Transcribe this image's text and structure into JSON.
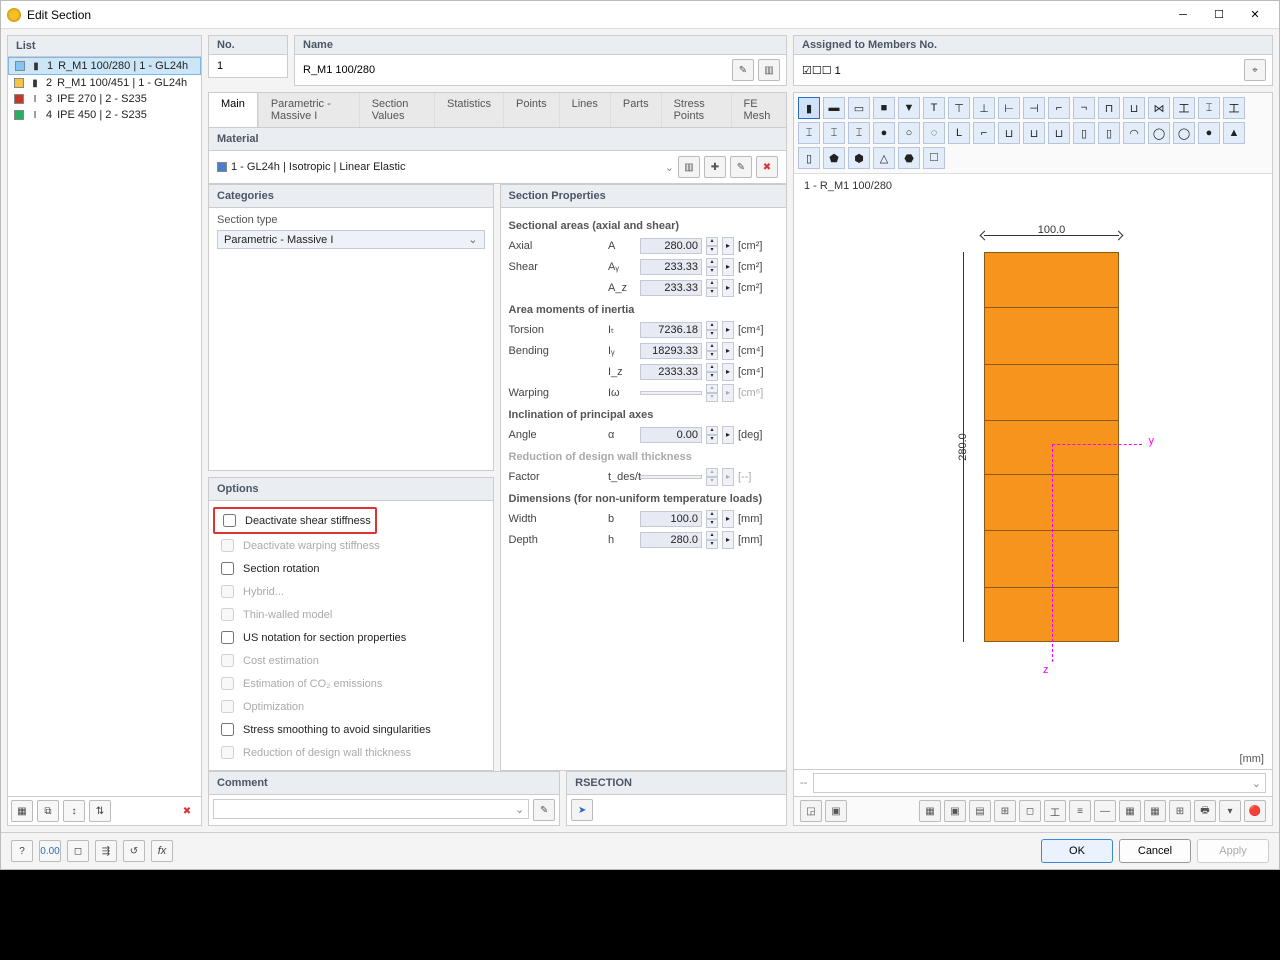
{
  "title": "Edit Section",
  "left": {
    "header": "List",
    "items": [
      {
        "idx": "1",
        "name": "R_M1 100/280 | 1 - GL24h",
        "color": "#7ec6f5",
        "shape": "rect",
        "selected": true
      },
      {
        "idx": "2",
        "name": "R_M1 100/451 | 1 - GL24h",
        "color": "#f4c542",
        "shape": "rect"
      },
      {
        "idx": "3",
        "name": "IPE 270 | 2 - S235",
        "color": "#c0392b",
        "shape": "I"
      },
      {
        "idx": "4",
        "name": "IPE 450 | 2 - S235",
        "color": "#27ae60",
        "shape": "I"
      }
    ]
  },
  "top": {
    "noLabel": "No.",
    "noVal": "1",
    "nameLabel": "Name",
    "nameVal": "R_M1 100/280",
    "assignLabel": "Assigned to Members No.",
    "assignVal": "☑☐☐ 1"
  },
  "tabs": [
    "Main",
    "Parametric - Massive I",
    "Section Values",
    "Statistics",
    "Points",
    "Lines",
    "Parts",
    "Stress Points",
    "FE Mesh"
  ],
  "material": {
    "header": "Material",
    "value": "1 - GL24h | Isotropic | Linear Elastic",
    "sw": "#4a7fc9"
  },
  "categories": {
    "header": "Categories",
    "label": "Section type",
    "value": "Parametric - Massive I"
  },
  "options": {
    "header": "Options",
    "list": [
      {
        "label": "Deactivate shear stiffness",
        "checked": false,
        "disabled": false,
        "highlight": true
      },
      {
        "label": "Deactivate warping stiffness",
        "checked": false,
        "disabled": true
      },
      {
        "label": "Section rotation",
        "checked": false,
        "disabled": false
      },
      {
        "label": "Hybrid...",
        "checked": false,
        "disabled": true
      },
      {
        "label": "Thin-walled model",
        "checked": false,
        "disabled": true
      },
      {
        "label": "US notation for section properties",
        "checked": false,
        "disabled": false
      },
      {
        "label": "Cost estimation",
        "checked": false,
        "disabled": true
      },
      {
        "label": "Estimation of CO₂ emissions",
        "checked": false,
        "disabled": true
      },
      {
        "label": "Optimization",
        "checked": false,
        "disabled": true
      },
      {
        "label": "Stress smoothing to avoid singularities",
        "checked": false,
        "disabled": false
      },
      {
        "label": "Reduction of design wall thickness",
        "checked": false,
        "disabled": true
      }
    ]
  },
  "props": {
    "header": "Section Properties",
    "g1": {
      "h": "Sectional areas (axial and shear)",
      "rows": [
        {
          "lab": "Axial",
          "sym": "A",
          "val": "280.00",
          "unit": "[cm²]"
        },
        {
          "lab": "Shear",
          "sym": "Aᵧ",
          "val": "233.33",
          "unit": "[cm²]"
        },
        {
          "lab": "",
          "sym": "A_z",
          "val": "233.33",
          "unit": "[cm²]"
        }
      ]
    },
    "g2": {
      "h": "Area moments of inertia",
      "rows": [
        {
          "lab": "Torsion",
          "sym": "Iₜ",
          "val": "7236.18",
          "unit": "[cm⁴]"
        },
        {
          "lab": "Bending",
          "sym": "Iᵧ",
          "val": "18293.33",
          "unit": "[cm⁴]"
        },
        {
          "lab": "",
          "sym": "I_z",
          "val": "2333.33",
          "unit": "[cm⁴]"
        },
        {
          "lab": "Warping",
          "sym": "Iω",
          "val": "",
          "unit": "[cm⁶]",
          "dis": true
        }
      ]
    },
    "g3": {
      "h": "Inclination of principal axes",
      "rows": [
        {
          "lab": "Angle",
          "sym": "α",
          "val": "0.00",
          "unit": "[deg]"
        }
      ]
    },
    "g4": {
      "h": "Reduction of design wall thickness",
      "dis": true,
      "rows": [
        {
          "lab": "Factor",
          "sym": "t_des/t",
          "val": "",
          "unit": "[--]",
          "dis": true
        }
      ]
    },
    "g5": {
      "h": "Dimensions (for non-uniform temperature loads)",
      "rows": [
        {
          "lab": "Width",
          "sym": "b",
          "val": "100.0",
          "unit": "[mm]"
        },
        {
          "lab": "Depth",
          "sym": "h",
          "val": "280.0",
          "unit": "[mm]"
        }
      ]
    }
  },
  "comment": {
    "header": "Comment",
    "value": ""
  },
  "rsection": {
    "header": "RSECTION"
  },
  "preview": {
    "label": "1 - R_M1 100/280",
    "w": "100.0",
    "h": "280.0",
    "unit": "[mm]"
  },
  "buttons": {
    "ok": "OK",
    "cancel": "Cancel",
    "apply": "Apply"
  }
}
